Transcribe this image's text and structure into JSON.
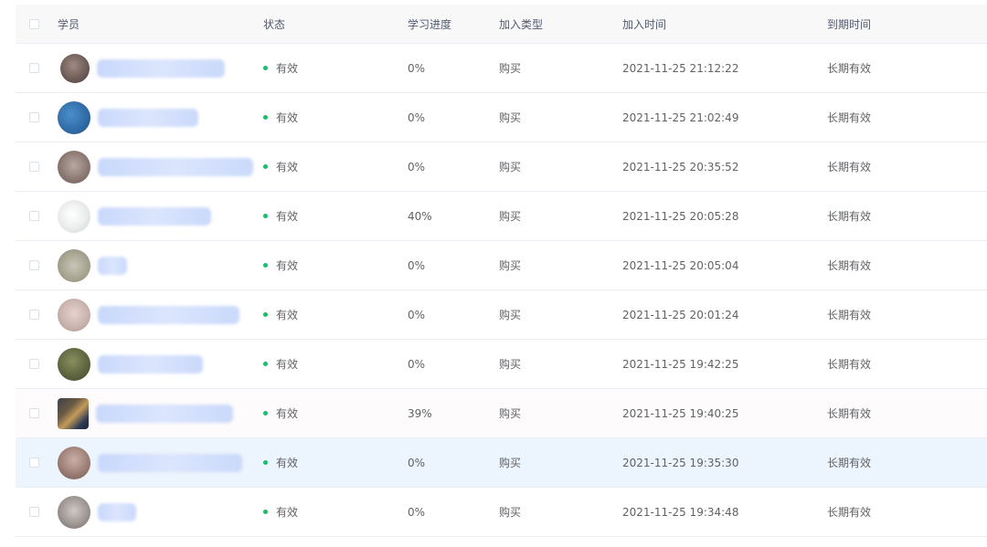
{
  "header": {
    "student": "学员",
    "status": "状态",
    "progress": "学习进度",
    "join_type": "加入类型",
    "join_time": "加入时间",
    "expire_time": "到期时间"
  },
  "colors": {
    "status_active": "#19be6b",
    "row_hover": "#ecf4fd",
    "header_bg": "#f8f8f9"
  },
  "rows": [
    {
      "status": "有效",
      "progress": "0%",
      "join_type": "购买",
      "join_time": "2021-11-25 21:12:22",
      "expire_time": "长期有效"
    },
    {
      "status": "有效",
      "progress": "0%",
      "join_type": "购买",
      "join_time": "2021-11-25 21:02:49",
      "expire_time": "长期有效"
    },
    {
      "status": "有效",
      "progress": "0%",
      "join_type": "购买",
      "join_time": "2021-11-25 20:35:52",
      "expire_time": "长期有效"
    },
    {
      "status": "有效",
      "progress": "40%",
      "join_type": "购买",
      "join_time": "2021-11-25 20:05:28",
      "expire_time": "长期有效"
    },
    {
      "status": "有效",
      "progress": "0%",
      "join_type": "购买",
      "join_time": "2021-11-25 20:05:04",
      "expire_time": "长期有效"
    },
    {
      "status": "有效",
      "progress": "0%",
      "join_type": "购买",
      "join_time": "2021-11-25 20:01:24",
      "expire_time": "长期有效"
    },
    {
      "status": "有效",
      "progress": "0%",
      "join_type": "购买",
      "join_time": "2021-11-25 19:42:25",
      "expire_time": "长期有效"
    },
    {
      "status": "有效",
      "progress": "39%",
      "join_type": "购买",
      "join_time": "2021-11-25 19:40:25",
      "expire_time": "长期有效"
    },
    {
      "status": "有效",
      "progress": "0%",
      "join_type": "购买",
      "join_time": "2021-11-25 19:35:30",
      "expire_time": "长期有效"
    },
    {
      "status": "有效",
      "progress": "0%",
      "join_type": "购买",
      "join_time": "2021-11-25 19:34:48",
      "expire_time": "长期有效"
    }
  ]
}
